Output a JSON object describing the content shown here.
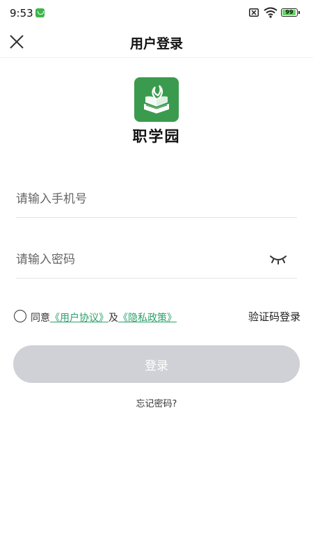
{
  "status_bar": {
    "time": "9:53",
    "battery_level": "99",
    "battery_fraction": 0.99
  },
  "nav": {
    "title": "用户登录",
    "close_icon": "close-icon"
  },
  "brand": {
    "app_name": "职学园",
    "logo_color": "#3a9b4e"
  },
  "form": {
    "phone_placeholder": "请输入手机号",
    "phone_value": "",
    "password_placeholder": "请输入密码",
    "password_value": "",
    "password_toggle_icon": "eye-closed-icon"
  },
  "agreement": {
    "prefix": "同意",
    "user_agreement": "《用户协议》",
    "joiner": "及",
    "privacy_policy": "《隐私政策》",
    "link_color": "#2aa06a",
    "checked": false
  },
  "sms_login_label": "验证码登录",
  "login_button": {
    "label": "登录",
    "color": "#cfd1d6"
  },
  "forgot_password": "忘记密码?"
}
